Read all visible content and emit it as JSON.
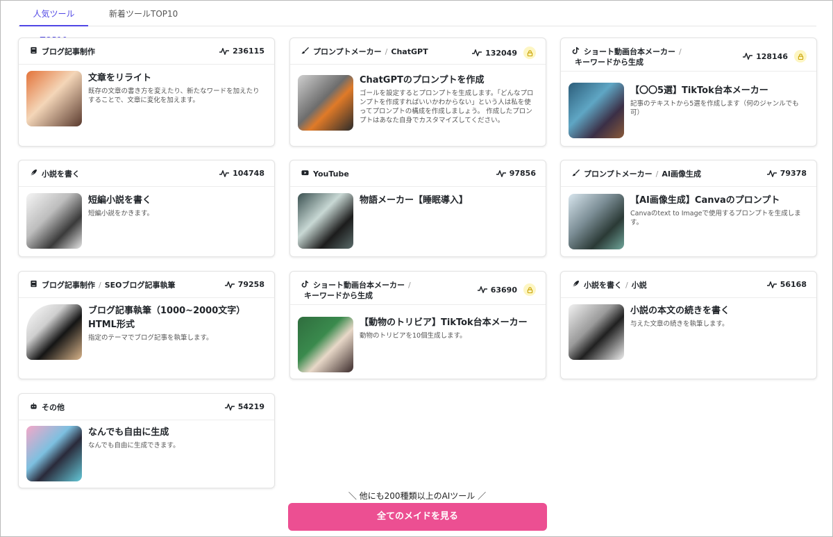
{
  "tabs": [
    {
      "label": "人気ツールTOP10",
      "active": true
    },
    {
      "label": "新着ツールTOP10",
      "active": false
    }
  ],
  "cards": [
    {
      "category": "ブログ記事制作",
      "category_icon": "book-icon",
      "sub": "",
      "count": "236115",
      "locked": false,
      "title": "文章をリライト",
      "desc": "既存の文章の書き方を変えたり、新たなワードを加えたりすることで、文章に変化を加えます。"
    },
    {
      "category": "プロンプトメーカー",
      "category_icon": "brush-icon",
      "sub": "ChatGPT",
      "count": "132049",
      "locked": true,
      "title": "ChatGPTのプロンプトを作成",
      "desc": "ゴールを設定するとプロンプトを生成します。「どんなプロンプトを作成すればいいかわからない」という人は私を使ってプロンプトの構成を作成しましょう。 作成したプロンプトはあなた自身でカスタマイズしてください。"
    },
    {
      "category": "ショート動画台本メーカー",
      "category_icon": "tiktok-icon",
      "sub": "キーワードから生成",
      "count": "128146",
      "locked": true,
      "title": "【〇〇5選】TikTok台本メーカー",
      "desc": "記事のテキストから5選を作成します（何のジャンルでも可）"
    },
    {
      "category": "小説を書く",
      "category_icon": "pen-icon",
      "sub": "",
      "count": "104748",
      "locked": false,
      "title": "短編小説を書く",
      "desc": "短編小説をかきます。"
    },
    {
      "category": "YouTube",
      "category_icon": "youtube-icon",
      "sub": "",
      "count": "97856",
      "locked": false,
      "title": "物語メーカー【睡眠導入】",
      "desc": ""
    },
    {
      "category": "プロンプトメーカー",
      "category_icon": "brush-icon",
      "sub": "AI画像生成",
      "count": "79378",
      "locked": false,
      "title": "【AI画像生成】Canvaのプロンプト",
      "desc": "Canvaのtext to Imageで使用するプロンプトを生成します。"
    },
    {
      "category": "ブログ記事制作",
      "category_icon": "book-icon",
      "sub": "SEOブログ記事執筆",
      "count": "79258",
      "locked": false,
      "title": "ブログ記事執筆（1000~2000文字）HTML形式",
      "desc": "指定のテーマでブログ記事を執筆します。"
    },
    {
      "category": "ショート動画台本メーカー",
      "category_icon": "tiktok-icon",
      "sub": "キーワードから生成",
      "count": "63690",
      "locked": true,
      "title": "【動物のトリビア】TikTok台本メーカー",
      "desc": "動物のトリビアを10個生成します。"
    },
    {
      "category": "小説を書く",
      "category_icon": "pen-icon",
      "sub": "小説",
      "count": "56168",
      "locked": false,
      "title": "小説の本文の続きを書く",
      "desc": "与えた文章の続きを執筆します。"
    },
    {
      "category": "その他",
      "category_icon": "robot-icon",
      "sub": "",
      "count": "54219",
      "locked": false,
      "title": "なんでも自由に生成",
      "desc": "なんでも自由に生成できます。"
    }
  ],
  "footer": {
    "more_text": "＼ 他にも200種類以上のAIツール ／",
    "button_label": "全てのメイドを見る"
  },
  "colors": {
    "accent": "#4f46e5",
    "button": "#ec4f92",
    "lock_bg": "#fdf6c3"
  }
}
